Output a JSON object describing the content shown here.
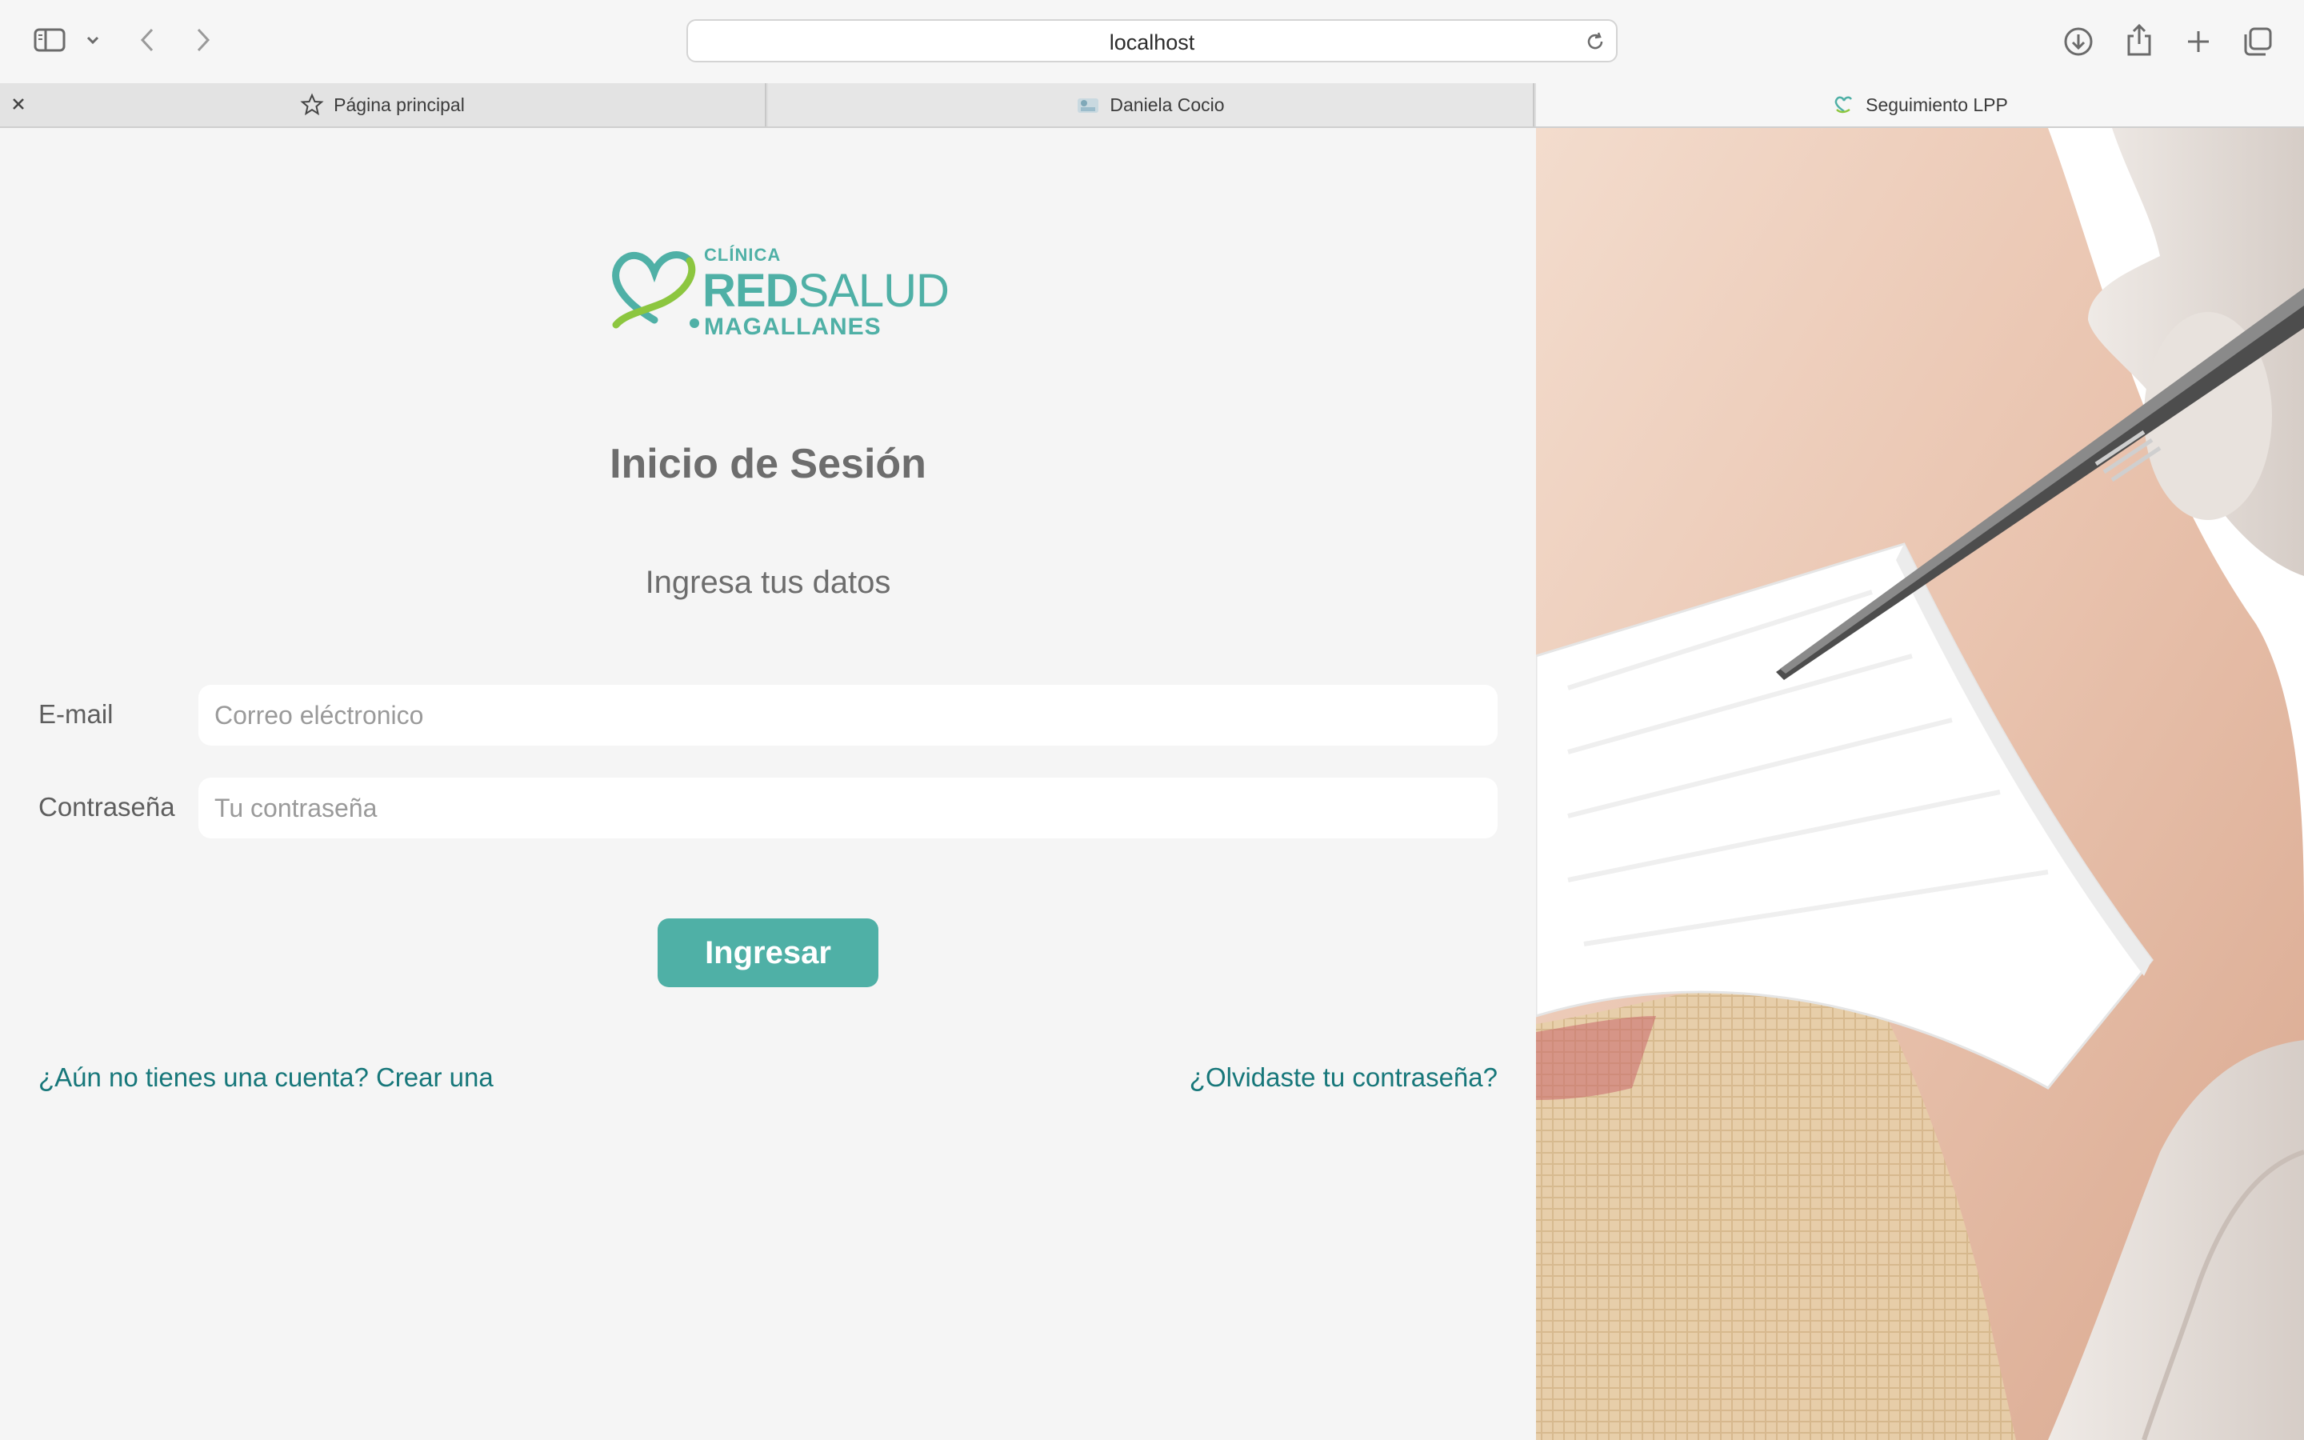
{
  "browser": {
    "url": "localhost",
    "tabs": [
      {
        "label": "Página principal",
        "icon": "star-icon"
      },
      {
        "label": "Daniela Cocio",
        "icon": "site-favicon"
      },
      {
        "label": "Seguimiento LPP",
        "icon": "heart-favicon",
        "active": true
      }
    ]
  },
  "logo": {
    "sup": "CLÍNICA",
    "main_bold": "RED",
    "main_light": "SALUD",
    "sub": "MAGALLANES",
    "colors": {
      "teal": "#4fb0a6",
      "green": "#8cc63f"
    }
  },
  "login": {
    "title": "Inicio de Sesión",
    "subtitle": "Ingresa tus datos",
    "email_label": "E-mail",
    "email_placeholder": "Correo eléctronico",
    "password_label": "Contraseña",
    "password_placeholder": "Tu contraseña",
    "submit_label": "Ingresar",
    "signup_link": "¿Aún no tienes una cuenta? Crear una",
    "forgot_link": "¿Olvidaste tu contraseña?"
  },
  "colors": {
    "accent": "#4fb0a6",
    "link": "#17777a",
    "background": "#f5f5f5"
  }
}
